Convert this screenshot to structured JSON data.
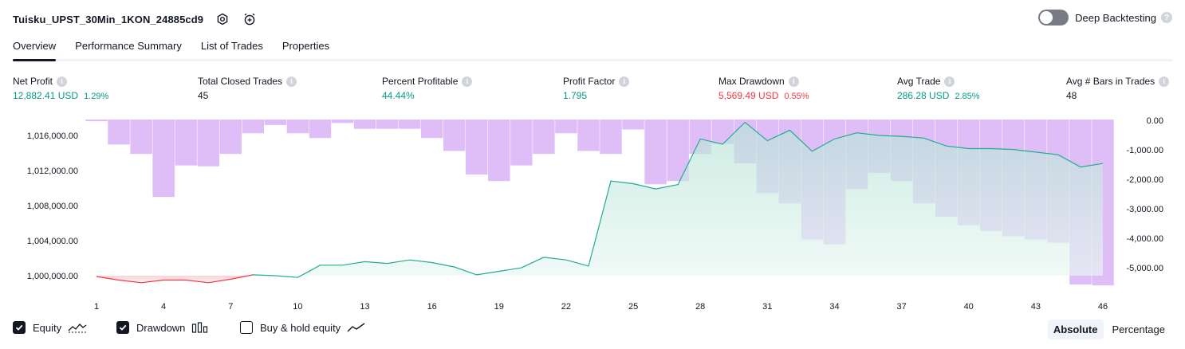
{
  "header": {
    "title": "Tuisku_UPST_30Min_1KON_24885cd9",
    "icons": [
      "settings-icon",
      "add-alert-icon"
    ],
    "deep_backtesting_label": "Deep Backtesting",
    "deep_backtesting_enabled": false
  },
  "tabs": [
    {
      "label": "Overview",
      "active": true
    },
    {
      "label": "Performance Summary",
      "active": false
    },
    {
      "label": "List of Trades",
      "active": false
    },
    {
      "label": "Properties",
      "active": false
    }
  ],
  "metrics": {
    "net_profit": {
      "label": "Net Profit",
      "value": "12,882.41 USD",
      "sub": "1.29%"
    },
    "closed_trades": {
      "label": "Total Closed Trades",
      "value": "45"
    },
    "percent_profitable": {
      "label": "Percent Profitable",
      "value": "44.44%"
    },
    "profit_factor": {
      "label": "Profit Factor",
      "value": "1.795"
    },
    "max_drawdown": {
      "label": "Max Drawdown",
      "value": "5,569.49 USD",
      "sub": "0.55%"
    },
    "avg_trade": {
      "label": "Avg Trade",
      "value": "286.28 USD",
      "sub": "2.85%"
    },
    "avg_bars": {
      "label": "Avg # Bars in Trades",
      "value": "48"
    }
  },
  "legend": {
    "equity": {
      "label": "Equity",
      "checked": true
    },
    "drawdown": {
      "label": "Drawdown",
      "checked": true
    },
    "buy_hold": {
      "label": "Buy & hold equity",
      "checked": false
    }
  },
  "scale_toggle": {
    "absolute": "Absolute",
    "percentage": "Percentage",
    "selected": "Absolute"
  },
  "colors": {
    "accent": "#131722",
    "positive": "#089981",
    "negative": "#f23645",
    "drawdown_bar": "#d9b3f7",
    "equity_line": "#22ab94",
    "equity_fill": "#d5f0ea"
  },
  "chart_data": {
    "type": "area",
    "x_ticks": [
      "1",
      "4",
      "7",
      "10",
      "13",
      "16",
      "19",
      "22",
      "25",
      "28",
      "31",
      "34",
      "37",
      "40",
      "43",
      "46"
    ],
    "y_left_ticks": [
      "1,016,000.00",
      "1,012,000.00",
      "1,008,000.00",
      "1,004,000.00",
      "1,000,000.00"
    ],
    "y_right_ticks": [
      "0.00",
      "-1,000.00",
      "-2,000.00",
      "-3,000.00",
      "-4,000.00",
      "-5,000.00"
    ],
    "y_left_range": [
      998000,
      1018000
    ],
    "y_right_range": [
      -5900,
      100
    ],
    "x_range": [
      1,
      46
    ],
    "series": [
      {
        "name": "Equity",
        "axis": "left",
        "x": [
          1,
          2,
          3,
          4,
          5,
          6,
          7,
          8,
          9,
          10,
          11,
          12,
          13,
          14,
          15,
          16,
          17,
          18,
          19,
          20,
          21,
          22,
          23,
          24,
          25,
          26,
          27,
          28,
          29,
          30,
          31,
          32,
          33,
          34,
          35,
          36,
          37,
          38,
          39,
          40,
          41,
          42,
          43,
          44,
          45,
          46
        ],
        "values": [
          999900,
          999500,
          999200,
          999500,
          999500,
          999200,
          999600,
          1000100,
          1000000,
          999800,
          1001200,
          1001200,
          1001600,
          1001400,
          1001800,
          1001500,
          1001000,
          1000100,
          1000500,
          1000900,
          1002100,
          1001800,
          1001100,
          1010800,
          1010500,
          1009900,
          1010400,
          1015600,
          1015000,
          1017500,
          1015400,
          1016600,
          1014200,
          1015600,
          1016300,
          1016000,
          1015900,
          1015700,
          1014800,
          1014500,
          1014500,
          1014400,
          1014100,
          1013800,
          1012400,
          1012800
        ]
      },
      {
        "name": "Drawdown",
        "axis": "right",
        "x": [
          1,
          2,
          3,
          4,
          5,
          6,
          7,
          8,
          9,
          10,
          11,
          12,
          13,
          14,
          15,
          16,
          17,
          18,
          19,
          20,
          21,
          22,
          23,
          24,
          25,
          26,
          27,
          28,
          29,
          30,
          31,
          32,
          33,
          34,
          35,
          36,
          37,
          38,
          39,
          40,
          41,
          42,
          43,
          44,
          45,
          46
        ],
        "values": [
          -30,
          -820,
          -1140,
          -2600,
          -1530,
          -1560,
          -1140,
          -440,
          -160,
          -440,
          -600,
          -90,
          -290,
          -290,
          -290,
          -600,
          -1040,
          -1840,
          -2060,
          -1530,
          -1140,
          -440,
          -1040,
          -1140,
          -310,
          -2170,
          -2060,
          -1140,
          -800,
          -1460,
          -2470,
          -2820,
          -4040,
          -4210,
          -2330,
          -1780,
          -2060,
          -2820,
          -3270,
          -3560,
          -3750,
          -3930,
          -4040,
          -4150,
          -5570,
          -5600
        ]
      }
    ]
  }
}
